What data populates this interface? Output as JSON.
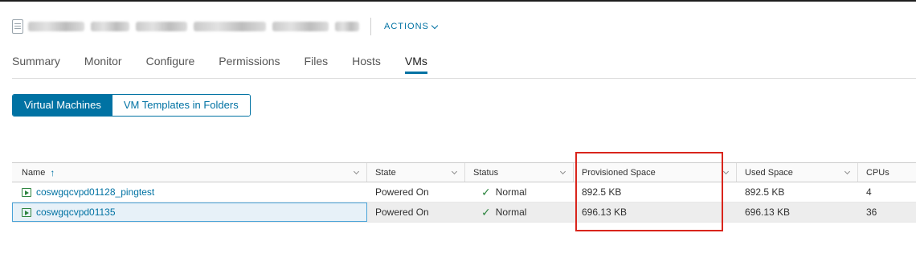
{
  "header": {
    "actions_label": "ACTIONS"
  },
  "tabs": [
    {
      "label": "Summary"
    },
    {
      "label": "Monitor"
    },
    {
      "label": "Configure"
    },
    {
      "label": "Permissions"
    },
    {
      "label": "Files"
    },
    {
      "label": "Hosts"
    },
    {
      "label": "VMs",
      "active": true
    }
  ],
  "view_toggle": {
    "virtual_machines": "Virtual Machines",
    "vm_templates": "VM Templates in Folders"
  },
  "grid": {
    "columns": {
      "name": "Name",
      "state": "State",
      "status": "Status",
      "provisioned_space": "Provisioned Space",
      "used_space": "Used Space",
      "cpus": "CPUs"
    },
    "rows": [
      {
        "name": "coswgqcvpd01128_pingtest",
        "state": "Powered On",
        "status": "Normal",
        "provisioned_space": "892.5 KB",
        "used_space": "892.5 KB",
        "cpus": "4"
      },
      {
        "name": "coswgqcvpd01135",
        "state": "Powered On",
        "status": "Normal",
        "provisioned_space": "696.13 KB",
        "used_space": "696.13 KB",
        "cpus": "36"
      }
    ]
  },
  "colors": {
    "accent": "#0072a3",
    "status_ok": "#2e8540",
    "highlight": "#d9251c"
  }
}
